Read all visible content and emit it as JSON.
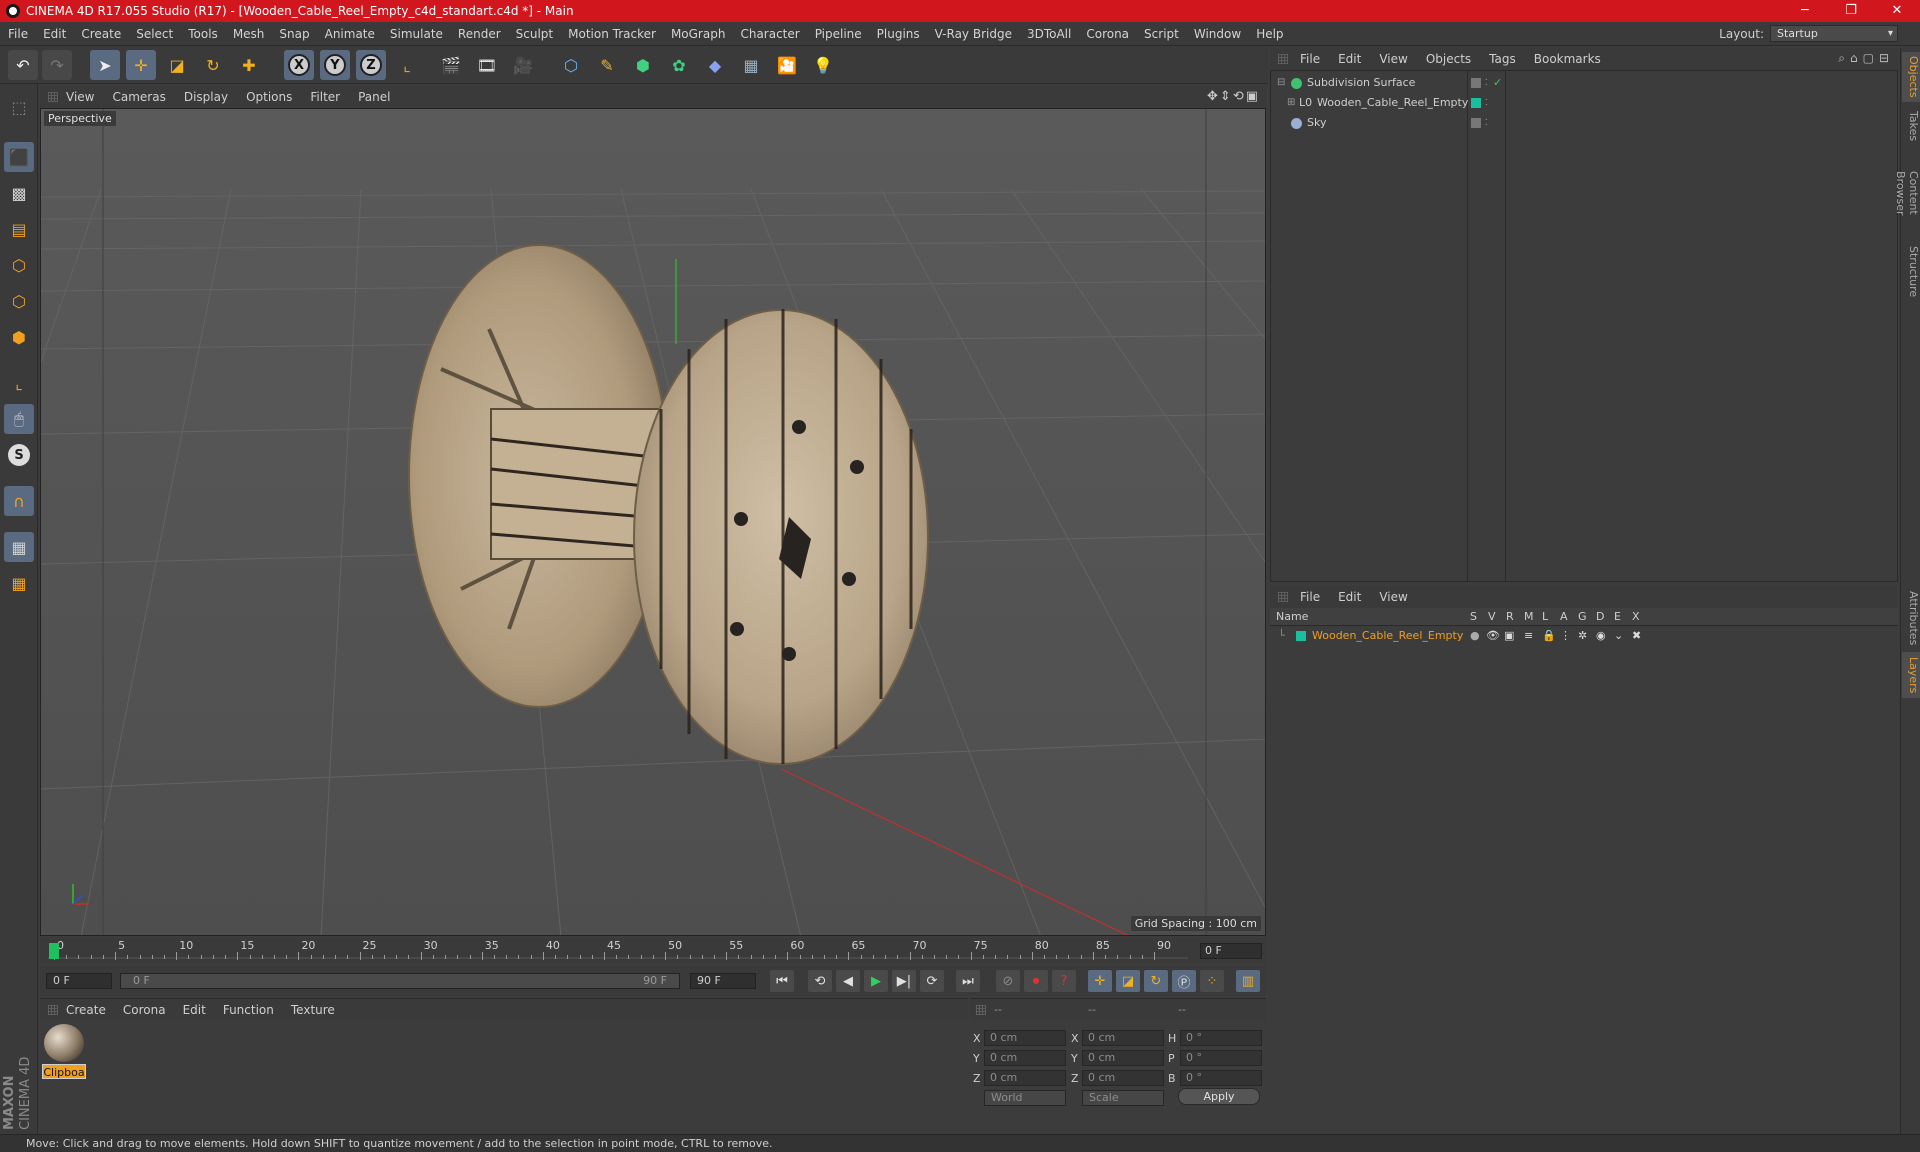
{
  "window": {
    "title": "CINEMA 4D R17.055 Studio (R17) - [Wooden_Cable_Reel_Empty_c4d_standart.c4d *] - Main",
    "min": "─",
    "max": "❐",
    "close": "✕"
  },
  "menu": [
    "File",
    "Edit",
    "Create",
    "Select",
    "Tools",
    "Mesh",
    "Snap",
    "Animate",
    "Simulate",
    "Render",
    "Sculpt",
    "Motion Tracker",
    "MoGraph",
    "Character",
    "Pipeline",
    "Plugins",
    "V-Ray Bridge",
    "3DToAll",
    "Corona",
    "Script",
    "Window",
    "Help"
  ],
  "layout": {
    "label": "Layout:",
    "value": "Startup"
  },
  "viewport": {
    "menu": [
      "View",
      "Cameras",
      "Display",
      "Options",
      "Filter",
      "Panel"
    ],
    "label": "Perspective",
    "grid_spacing": "Grid Spacing : 100 cm"
  },
  "timeline": {
    "ticks": [
      "0",
      "5",
      "10",
      "15",
      "20",
      "25",
      "30",
      "35",
      "40",
      "45",
      "50",
      "55",
      "60",
      "65",
      "70",
      "75",
      "80",
      "85",
      "90"
    ],
    "current_frame": "0 F",
    "start_field": "0 F",
    "range_start": "0 F",
    "range_end": "90 F",
    "end_field": "90 F"
  },
  "material": {
    "menu": [
      "Create",
      "Corona",
      "Edit",
      "Function",
      "Texture"
    ],
    "swatch_label": "Clipboa"
  },
  "coords": {
    "head": [
      "--",
      "--",
      "--"
    ],
    "rows": [
      {
        "a": "X",
        "av": "0 cm",
        "b": "X",
        "bv": "0 cm",
        "c": "H",
        "cv": "0 °"
      },
      {
        "a": "Y",
        "av": "0 cm",
        "b": "Y",
        "bv": "0 cm",
        "c": "P",
        "cv": "0 °"
      },
      {
        "a": "Z",
        "av": "0 cm",
        "b": "Z",
        "bv": "0 cm",
        "c": "B",
        "cv": "0 °"
      }
    ],
    "mode1": "World",
    "mode2": "Scale",
    "apply": "Apply"
  },
  "objects": {
    "menu": [
      "File",
      "Edit",
      "View",
      "Objects",
      "Tags",
      "Bookmarks"
    ],
    "items": [
      {
        "name": "Subdivision Surface"
      },
      {
        "name": "Wooden_Cable_Reel_Empty"
      },
      {
        "name": "Sky"
      }
    ]
  },
  "layers": {
    "menu": [
      "File",
      "Edit",
      "View"
    ],
    "columns": [
      "Name",
      "S",
      "V",
      "R",
      "M",
      "L",
      "A",
      "G",
      "D",
      "E",
      "X"
    ],
    "items": [
      {
        "name": "Wooden_Cable_Reel_Empty"
      }
    ]
  },
  "side_tabs": [
    "Objects",
    "Takes",
    "Content Browser",
    "Structure",
    "Attributes",
    "Layers"
  ],
  "status": "Move: Click and drag to move elements. Hold down SHIFT to quantize movement / add to the selection in point mode, CTRL to remove.",
  "logo": {
    "line1": "MAXON",
    "line2": "CINEMA 4D"
  },
  "colors": {
    "title_bar": "#d2161e",
    "accent": "#f0a020",
    "layer_color": "#19c0a0"
  }
}
